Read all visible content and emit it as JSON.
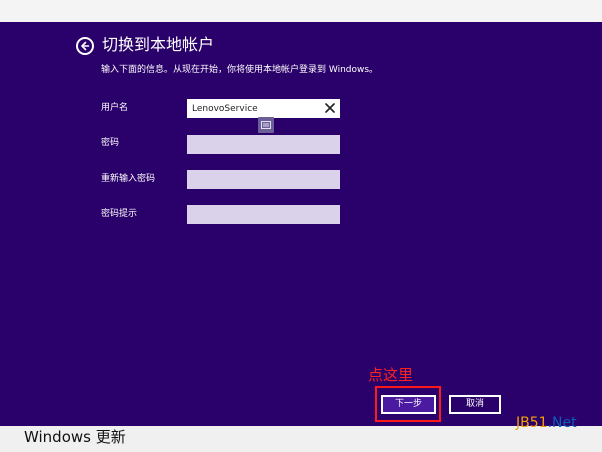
{
  "header": {
    "title": "切换到本地帐户",
    "subtitle": "输入下面的信息。从现在开始，你将使用本地帐户登录到 Windows。"
  },
  "form": {
    "username": {
      "label": "用户名",
      "value": "LenovoService"
    },
    "password": {
      "label": "密码",
      "value": ""
    },
    "confirm_password": {
      "label": "重新输入密码",
      "value": ""
    },
    "password_hint": {
      "label": "密码提示",
      "value": ""
    }
  },
  "buttons": {
    "next_label": "下一步",
    "cancel_label": "取消"
  },
  "annotation": {
    "text": "点这里",
    "color": "#ff1a1a"
  },
  "watermark": {
    "part1": "JB51",
    "part2": ".Net"
  },
  "footer": {
    "windows_update_label": "Windows 更新"
  },
  "colors": {
    "panel_background": "#2a006a",
    "input_background": "#d9d2ea",
    "next_button": "#4a1aa0"
  },
  "icons": {
    "back": "back-arrow-circle-icon",
    "clear": "close-icon",
    "keyboard": "keyboard-icon"
  }
}
